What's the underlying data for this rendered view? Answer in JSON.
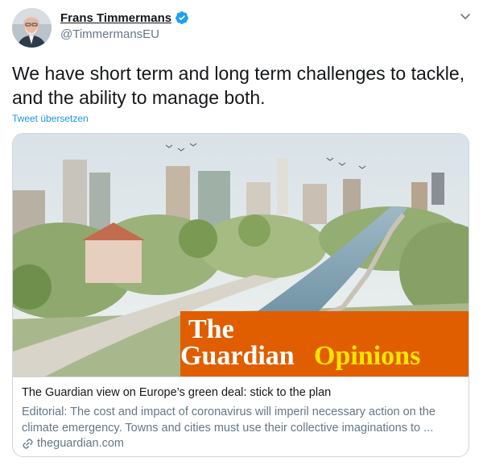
{
  "author": {
    "display_name": "Frans Timmermans",
    "handle": "@TimmermansEU",
    "verified": true
  },
  "tweet": {
    "text": "We have short term and long term challenges to tackle, and the ability to manage both.",
    "translate_label": "Tweet übersetzen"
  },
  "card": {
    "image_brand_word1": "The",
    "image_brand_word2": "Guardian",
    "image_brand_word3": "Opinions",
    "title": "The Guardian view on Europe’s green deal: stick to the plan",
    "description": "Editorial: The cost and impact of coronavirus will imperil necessary action on the climate emergency. Towns and cities must use their collective imaginations to ...",
    "domain": "theguardian.com"
  },
  "icons": {
    "verified": "verified-badge-icon",
    "menu": "chevron-down-icon",
    "link": "link-icon"
  },
  "colors": {
    "text": "#14171a",
    "secondary": "#657786",
    "link": "#1b95e0",
    "verified": "#1da1f2",
    "guardian_orange": "#e05e00",
    "guardian_yellow": "#ffe500"
  }
}
